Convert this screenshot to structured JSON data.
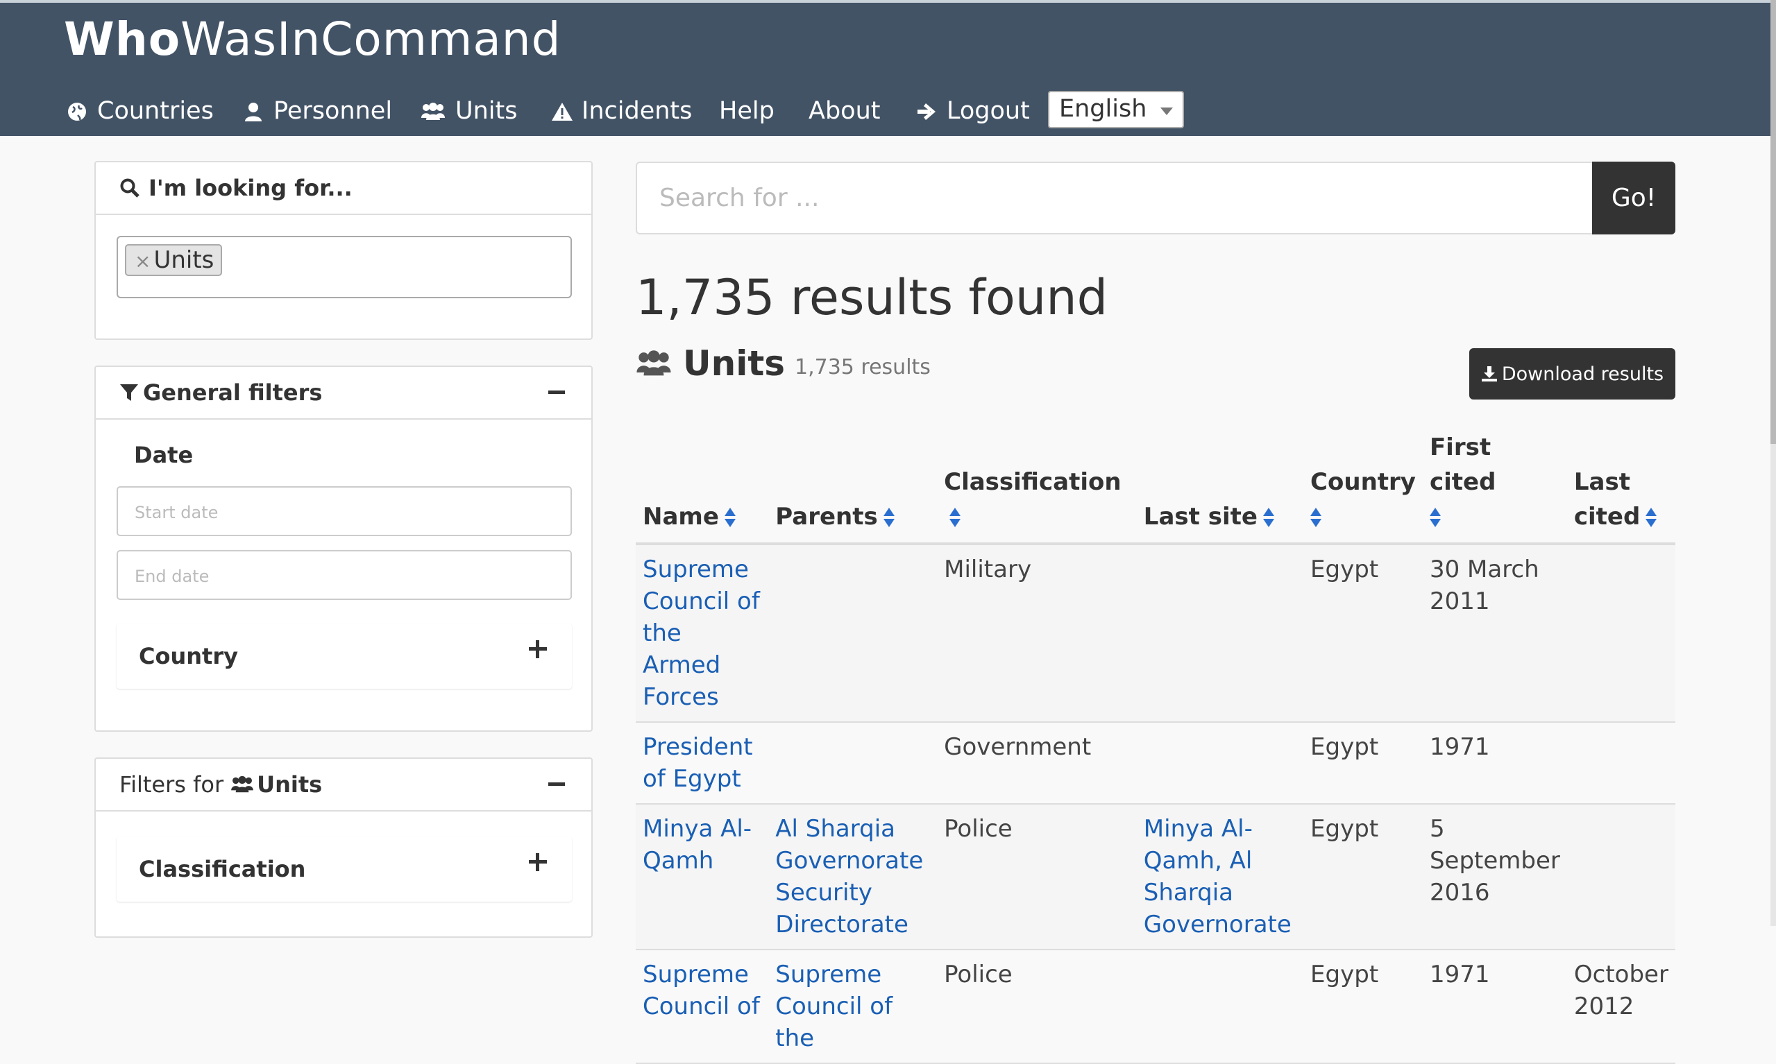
{
  "brand": {
    "bold": "Who",
    "regular": "WasInCommand"
  },
  "nav": [
    {
      "label": "Countries",
      "icon": "globe-icon"
    },
    {
      "label": "Personnel",
      "icon": "user-icon"
    },
    {
      "label": "Units",
      "icon": "users-icon"
    },
    {
      "label": "Incidents",
      "icon": "warning-icon"
    },
    {
      "label": "Help",
      "icon": ""
    },
    {
      "label": "About",
      "icon": ""
    },
    {
      "label": "Logout",
      "icon": "arrow-right-icon"
    }
  ],
  "language": {
    "selected": "English"
  },
  "sidebar": {
    "looking_for": {
      "title": "I'm looking for...",
      "tag": "Units"
    },
    "general": {
      "title": "General filters",
      "date_label": "Date",
      "start_placeholder": "Start date",
      "end_placeholder": "End date",
      "country_label": "Country"
    },
    "unit_filters": {
      "prefix": "Filters for",
      "entity": "Units",
      "classification_label": "Classification"
    }
  },
  "search": {
    "placeholder": "Search for ...",
    "go": "Go!"
  },
  "results": {
    "title": "1,735 results found",
    "section_title": "Units",
    "section_count": "1,735 results",
    "download": "Download results"
  },
  "table": {
    "headers": [
      "Name",
      "Parents",
      "Classification",
      "Last site",
      "Country",
      "First cited",
      "Last cited"
    ],
    "rows": [
      {
        "name": "Supreme Council of the Armed Forces",
        "parents": "",
        "classification": "Military",
        "last_site": "",
        "country": "Egypt",
        "first_cited": "30 March 2011",
        "last_cited": ""
      },
      {
        "name": "President of Egypt",
        "parents": "",
        "classification": "Government",
        "last_site": "",
        "country": "Egypt",
        "first_cited": "1971",
        "last_cited": ""
      },
      {
        "name": "Minya Al-Qamh",
        "parents": "Al Sharqia Governorate Security Directorate",
        "classification": "Police",
        "last_site": "Minya Al-Qamh, Al Sharqia Governorate",
        "country": "Egypt",
        "first_cited": "5 September 2016",
        "last_cited": ""
      },
      {
        "name": "Supreme Council of",
        "parents": "Supreme Council of the",
        "classification": "Police",
        "last_site": "",
        "country": "Egypt",
        "first_cited": "1971",
        "last_cited": "October 2012"
      }
    ]
  }
}
